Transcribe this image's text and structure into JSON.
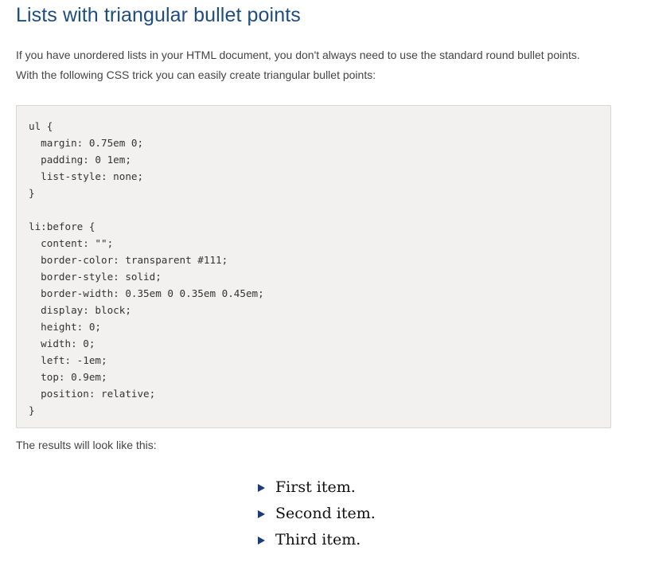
{
  "article": {
    "title": "Lists with triangular bullet points",
    "intro_line_1": "If you have unordered lists in your HTML document, you don't always need to use the standard round bullet points.",
    "intro_line_2": "With the following CSS trick you can easily create triangular bullet points:",
    "code": "ul {\n  margin: 0.75em 0;\n  padding: 0 1em;\n  list-style: none;\n}\n\nli:before {\n  content: \"\";\n  border-color: transparent #111;\n  border-style: solid;\n  border-width: 0.35em 0 0.35em 0.45em;\n  display: block;\n  height: 0;\n  width: 0;\n  left: -1em;\n  top: 0.9em;\n  position: relative;\n}",
    "results_label": "The results will look like this:",
    "demo_items": [
      "First item.",
      "Second item.",
      "Third item."
    ]
  },
  "colors": {
    "title": "#1e4d80",
    "code_background": "#f3f1ef",
    "bullet": "#1e3a78"
  },
  "icons": {
    "bullet": "triangle-right-icon"
  }
}
